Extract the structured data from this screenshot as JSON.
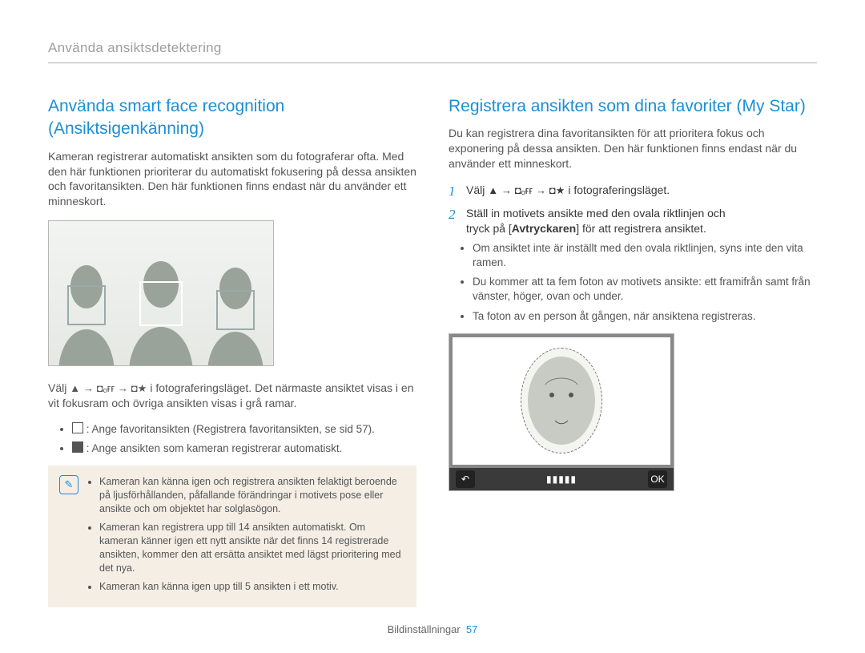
{
  "header": {
    "breadcrumb": "Använda ansiktsdetektering"
  },
  "left": {
    "heading": "Använda smart face recognition (Ansiktsigenkänning)",
    "intro": "Kameran registrerar automatiskt ansikten som du fotograferar ofta. Med den här funktionen prioriterar du automatiskt fokusering på dessa ansikten och favoritansikten. Den här funktionen finns endast när du använder ett minneskort.",
    "select_prefix": "Välj ",
    "select_mid": "   i fotograferingsläget. Det närmaste ansiktet visas i en vit fokusram och övriga ansikten visas i grå ramar.",
    "bullets": [
      " : Ange favoritansikten (Registrera favoritansikten, se sid 57).",
      " : Ange ansikten som kameran registrerar automatiskt."
    ],
    "notes": [
      "Kameran kan känna igen och registrera ansikten felaktigt beroende på ljusförhållanden, påfallande förändringar i motivets pose eller ansikte och om objektet har solglasögon.",
      "Kameran kan registrera upp till 14 ansikten automatiskt. Om kameran känner igen ett nytt ansikte när det finns 14 registrerade ansikten, kommer den att ersätta ansiktet med lägst prioritering med det nya.",
      "Kameran kan känna igen upp till 5 ansikten i ett motiv."
    ]
  },
  "right": {
    "heading": "Registrera ansikten som dina favoriter (My Star)",
    "intro": "Du kan registrera dina favoritansikten för att prioritera fokus och exponering på dessa ansikten. Den här funktionen finns endast när du använder ett minneskort.",
    "step1_pre": "Välj ",
    "step1_post": "   i fotograferingsläget.",
    "step2_line1": "Ställ in motivets ansikte med den ovala riktlinjen och",
    "step2_line2_pre": "tryck på [",
    "step2_shutter": "Avtryckaren",
    "step2_line2_post": "] för att registrera ansiktet.",
    "bullets": [
      "Om ansiktet inte är inställt med den ovala riktlinjen, syns inte den vita ramen.",
      "Du kommer att ta fem foton av motivets ansikte: ett framifrån samt från vänster, höger, ovan och under.",
      "Ta foton av en person åt gången, när ansiktena registreras."
    ],
    "back_label": "↶",
    "ok_label": "OK",
    "gauge": "▮▮▮▮▮"
  },
  "footer": {
    "section": "Bildinställningar",
    "page": "57"
  },
  "icons": {
    "arrow": "→",
    "up_tri": "▲",
    "face_off": "◘ₒғғ",
    "face_star": "◘★"
  }
}
